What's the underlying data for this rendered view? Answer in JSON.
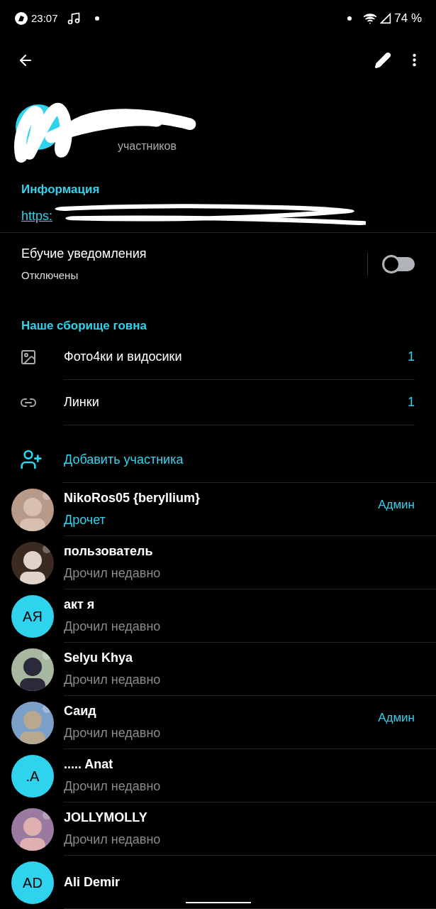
{
  "status_bar": {
    "time": "23:07",
    "battery": "74 %"
  },
  "header": {
    "subtitle": "участников"
  },
  "info": {
    "heading": "Информация",
    "link": "https:"
  },
  "notifications": {
    "title": "Ебучие уведомления",
    "subtitle": "Отключены",
    "on": false
  },
  "media": {
    "heading": "Наше сборище говна",
    "items": [
      {
        "label": "Фото4ки и видосики",
        "count": "1"
      },
      {
        "kind": "link",
        "label": "Линки",
        "count": "1"
      }
    ]
  },
  "add_member": {
    "label": "Добавить участника"
  },
  "members": [
    {
      "name": "NikoRos05 {beryllium}",
      "status": "Дрочет",
      "online": true,
      "role": "Админ"
    },
    {
      "name": "пользователь",
      "status": "Дрочил недавно",
      "online": false
    },
    {
      "avatar": {
        "kind": "initials",
        "text": "АЯ"
      },
      "name": "акт я",
      "status": "Дрочил недавно",
      "online": false
    },
    {
      "name": "Selyu Khya",
      "status": "Дрочил недавно",
      "online": false
    },
    {
      "name": "Саид",
      "status": "Дрочил недавно",
      "online": false,
      "role": "Админ"
    },
    {
      "avatar": {
        "kind": "initials",
        "text": ".A"
      },
      "name": "..... Anat",
      "status": "Дрочил недавно",
      "online": false
    },
    {
      "name": "JOLLYMOLLY",
      "status": "Дрочил недавно",
      "online": false
    },
    {
      "avatar": {
        "kind": "initials",
        "text": "AD"
      },
      "name": "Ali Demir"
    }
  ]
}
